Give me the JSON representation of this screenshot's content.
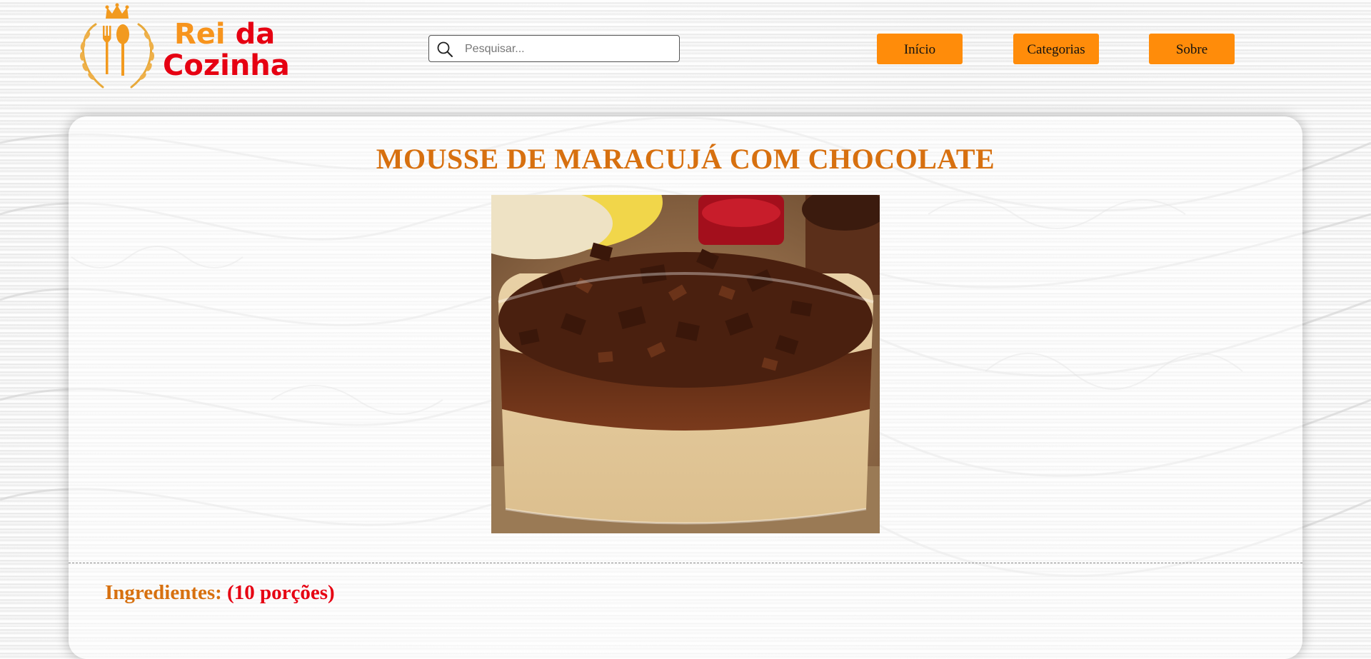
{
  "brand": {
    "name_part1": "Rei",
    "name_part2": "da",
    "name_part3": "Cozinha",
    "colors": {
      "orange": "#f7941d",
      "red": "#e60012"
    }
  },
  "search": {
    "placeholder": "Pesquisar...",
    "value": "",
    "icon": "search-icon"
  },
  "nav": {
    "items": [
      {
        "label": "Início"
      },
      {
        "label": "Categorias"
      },
      {
        "label": "Sobre"
      }
    ],
    "button_color": "#ff8c0a"
  },
  "recipe": {
    "title": "MOUSSE DE MARACUJÁ COM CHOCOLATE",
    "title_color": "#d7700f",
    "ingredients_label": "Ingredientes:",
    "ingredients_portions": "(10 porções)"
  }
}
